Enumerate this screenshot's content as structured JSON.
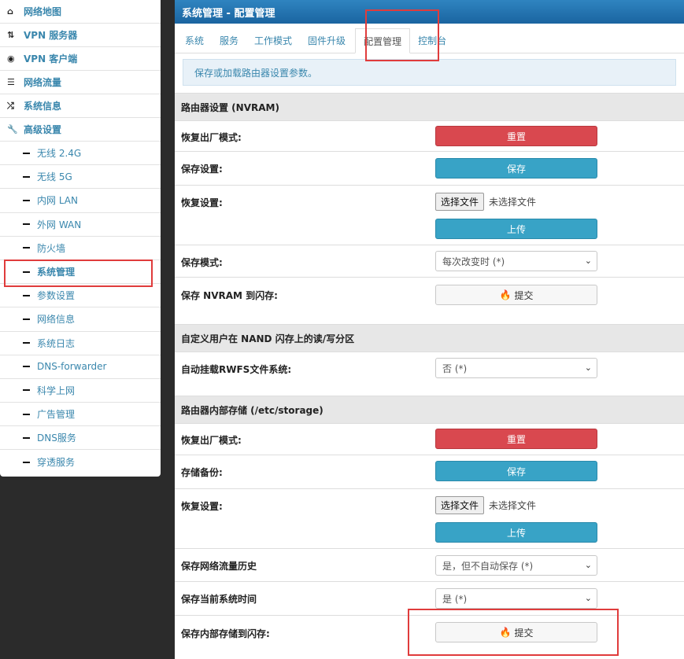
{
  "sidebar": {
    "main_items": [
      {
        "label": "网络地图",
        "icon": "home-icon"
      },
      {
        "label": "VPN 服务器",
        "icon": "vpn-server-icon"
      },
      {
        "label": "VPN 客户端",
        "icon": "globe-icon"
      },
      {
        "label": "网络流量",
        "icon": "traffic-icon"
      },
      {
        "label": "系统信息",
        "icon": "shuffle-icon"
      },
      {
        "label": "高级设置",
        "icon": "wrench-icon"
      }
    ],
    "sub_items": [
      "无线 2.4G",
      "无线 5G",
      "内网 LAN",
      "外网 WAN",
      "防火墙",
      "系统管理",
      "参数设置",
      "网络信息",
      "系统日志",
      "DNS-forwarder",
      "科学上网",
      "广告管理",
      "DNS服务",
      "穿透服务"
    ],
    "active_sub": "系统管理"
  },
  "header": {
    "title": "系统管理 - 配置管理"
  },
  "tabs": [
    "系统",
    "服务",
    "工作模式",
    "固件升级",
    "配置管理",
    "控制台"
  ],
  "active_tab": "配置管理",
  "info": "保存或加载路由器设置参数。",
  "sections": {
    "nvram": {
      "title": "路由器设置 (NVRAM)",
      "factory_label": "恢复出厂模式:",
      "factory_btn": "重置",
      "save_label": "保存设置:",
      "save_btn": "保存",
      "restore_label": "恢复设置:",
      "file_btn": "选择文件",
      "file_none": "未选择文件",
      "upload_btn": "上传",
      "save_mode_label": "保存模式:",
      "save_mode_value": "每次改变时 (*)",
      "flash_label": "保存 NVRAM 到闪存:",
      "flash_btn": "提交"
    },
    "nand": {
      "title": "自定义用户在 NAND 闪存上的读/写分区",
      "mount_label": "自动挂载RWFS文件系统:",
      "mount_value": "否 (*)"
    },
    "storage": {
      "title": "路由器内部存储 (/etc/storage)",
      "factory_label": "恢复出厂模式:",
      "factory_btn": "重置",
      "backup_label": "存储备份:",
      "backup_btn": "保存",
      "restore_label": "恢复设置:",
      "file_btn": "选择文件",
      "file_none": "未选择文件",
      "upload_btn": "上传",
      "traffic_label": "保存网络流量历史",
      "traffic_value": "是，但不自动保存 (*)",
      "time_label": "保存当前系统时间",
      "time_value": "是 (*)",
      "flash_label": "保存内部存储到闪存:",
      "flash_btn": "提交"
    }
  },
  "colors": {
    "accent": "#1f6fa8",
    "link": "#3a87ad",
    "danger": "#d9484f",
    "info": "#38a3c6",
    "highlight": "#e03c3c"
  }
}
